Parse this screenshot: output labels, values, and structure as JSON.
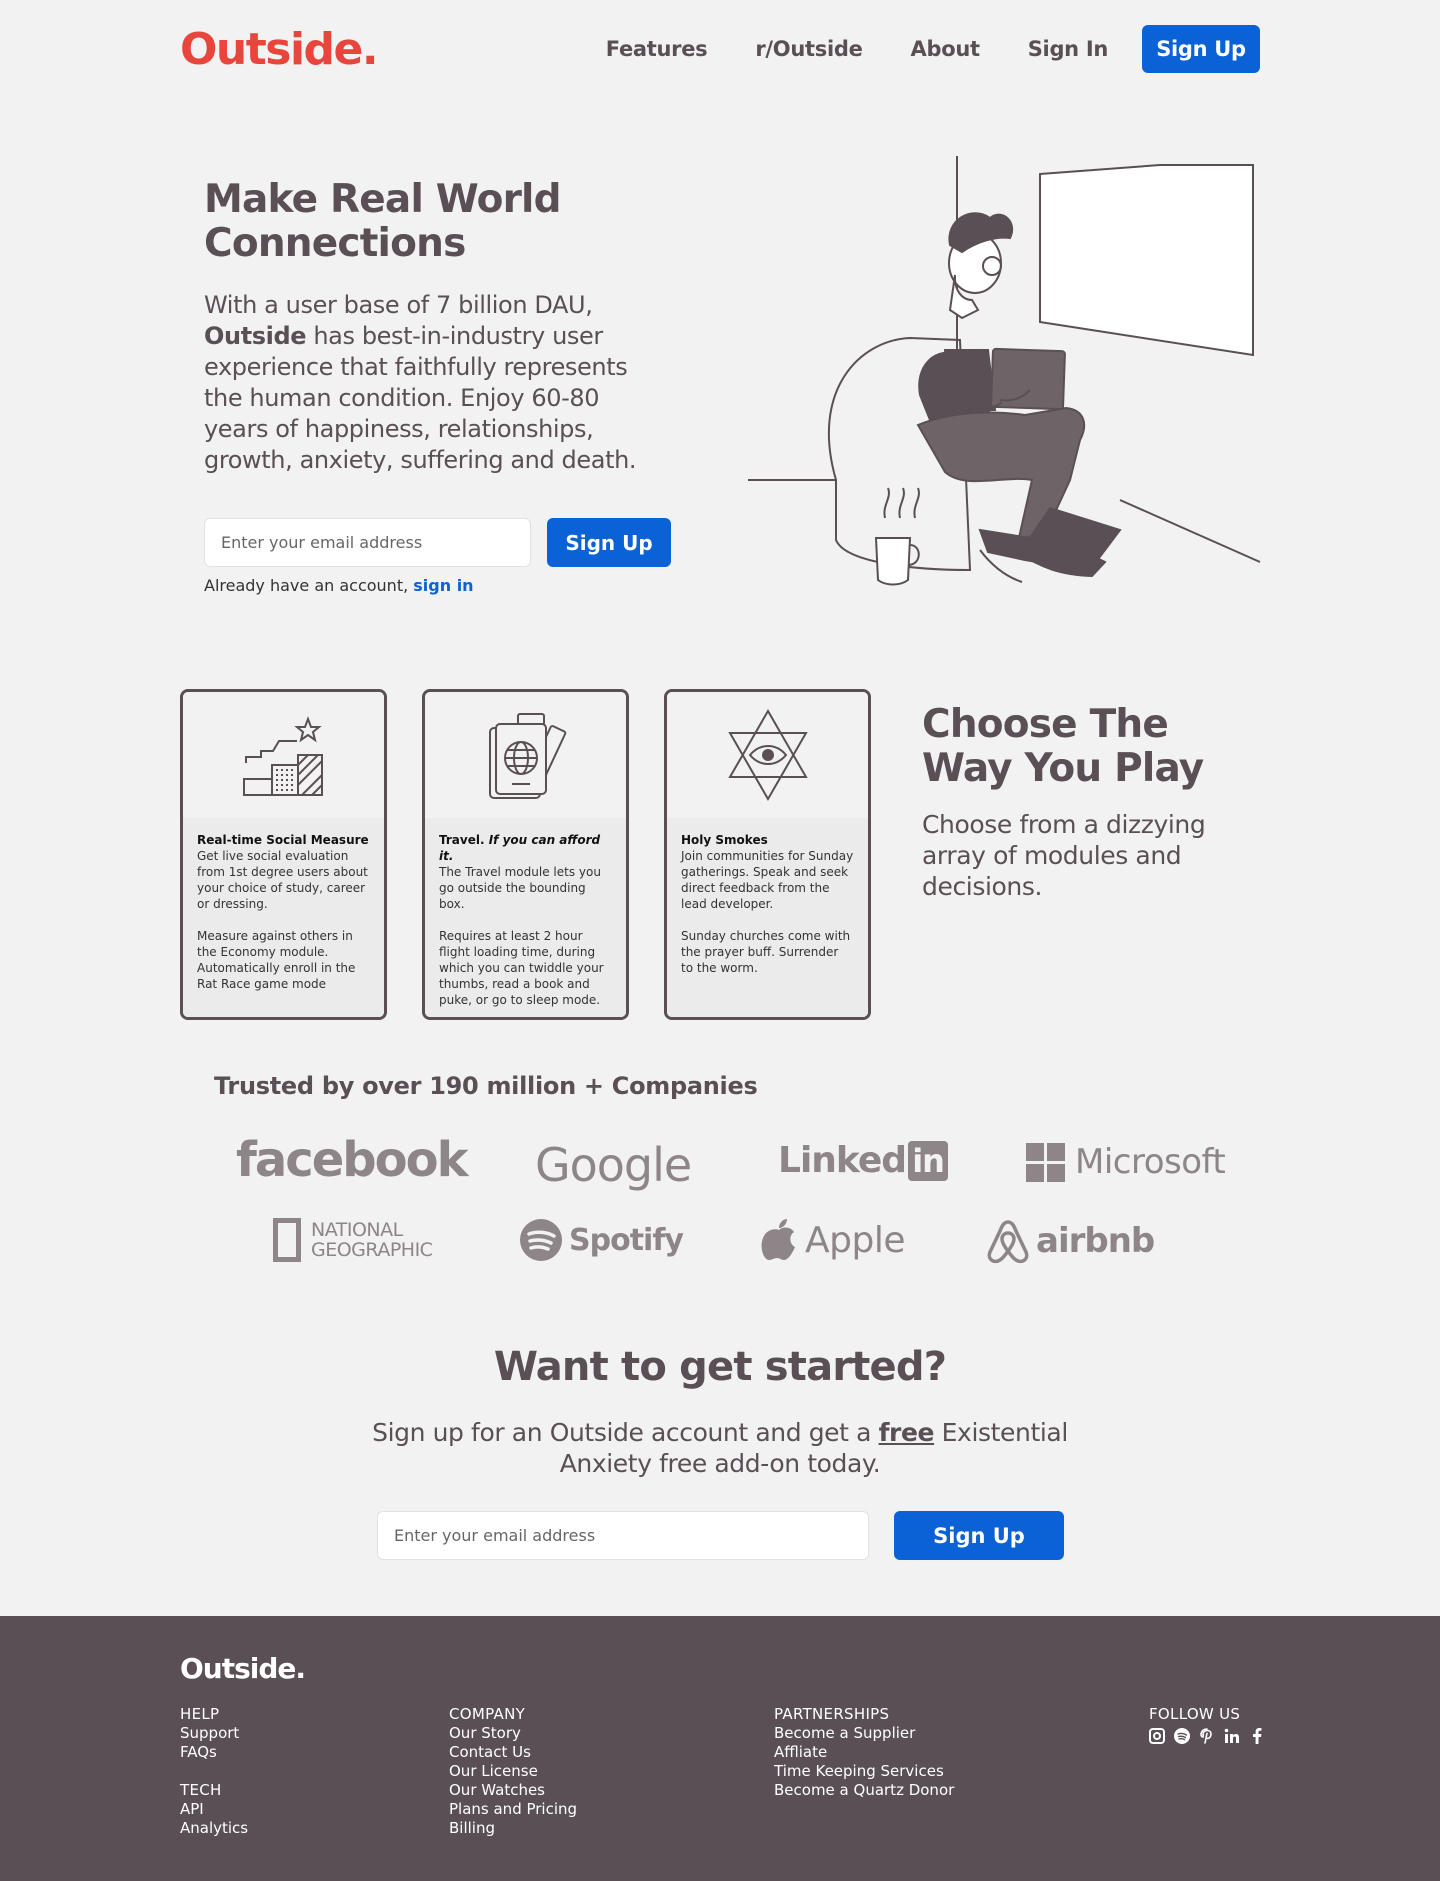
{
  "header": {
    "logo": "Outside.",
    "nav": [
      "Features",
      "r/Outside",
      "About",
      "Sign In"
    ],
    "signup_label": "Sign Up"
  },
  "hero": {
    "title": "Make Real World Connections",
    "text_1": "With a user base of 7 billion DAU,",
    "text_bold": "Outside",
    "text_2": " has best-in-industry user experience that faithfully represents the human condition. Enjoy 60-80 years of happiness, relationships, growth, anxiety, suffering and death.",
    "email_placeholder": "Enter your email address",
    "signup_label": "Sign Up",
    "signin_prefix": "Already have an account, ",
    "signin_link": "sign in"
  },
  "cards": [
    {
      "title": "Real-time Social Measure",
      "p1": "Get live social evaluation from 1st degree users about your choice of study, career or dressing.",
      "p2": "Measure against others in the Economy module. Automatically enroll in the Rat Race game mode",
      "icon": "chart-stars-icon"
    },
    {
      "title": "Travel.",
      "title_italic": "If you can afford it.",
      "p1": "The Travel module lets you go outside the bounding box.",
      "p2": "Requires at least 2 hour flight loading time, during which you can twiddle your thumbs, read a book and puke, or go to sleep mode.",
      "icon": "passport-icon"
    },
    {
      "title": "Holy Smokes",
      "p1": "Join communities for Sunday gatherings. Speak and seek direct feedback from the lead developer.",
      "p2": "Sunday churches come with the prayer buff. Surrender to the worm.",
      "icon": "star-eye-icon"
    }
  ],
  "play": {
    "title": "Choose The Way You Play",
    "text": "Choose from a dizzying array of modules and decisions."
  },
  "trusted": {
    "title": "Trusted by over 190 million + Companies",
    "logos": {
      "facebook": "facebook",
      "google": "Google",
      "linkedin": "Linked",
      "linkedin_box": "in",
      "microsoft": "Microsoft",
      "natgeo_1": "NATIONAL",
      "natgeo_2": "GEOGRAPHIC",
      "spotify": "Spotify",
      "apple": "Apple",
      "airbnb": "airbnb"
    }
  },
  "cta": {
    "title": "Want to get started?",
    "text_1": "Sign up for an Outside account and get a ",
    "text_free": "free",
    "text_2": " Existential Anxiety free add-on today.",
    "email_placeholder": "Enter your email address",
    "signup_label": "Sign Up"
  },
  "footer": {
    "logo": "Outside.",
    "help": {
      "heading": "HELP",
      "links": [
        "Support",
        "FAQs"
      ]
    },
    "tech": {
      "heading": "TECH",
      "links": [
        "API",
        "Analytics"
      ]
    },
    "company": {
      "heading": "COMPANY",
      "links": [
        "Our Story",
        "Contact Us",
        "Our License",
        "Our Watches",
        "Plans and Pricing",
        "Billing"
      ]
    },
    "partnerships": {
      "heading": "PARTNERSHIPS",
      "links": [
        "Become a Supplier",
        "Affliate",
        "Time Keeping Services",
        "Become a Quartz Donor"
      ]
    },
    "follow": {
      "heading": "FOLLOW US",
      "icons": [
        "instagram-icon",
        "spotify-icon",
        "pinterest-icon",
        "linkedin-icon",
        "facebook-icon"
      ]
    }
  },
  "colors": {
    "brand_red": "#e8453c",
    "primary_blue": "#0b62d6",
    "text_dark": "#594f55",
    "background": "#f2f2f2",
    "logo_gray": "#8d8588"
  }
}
